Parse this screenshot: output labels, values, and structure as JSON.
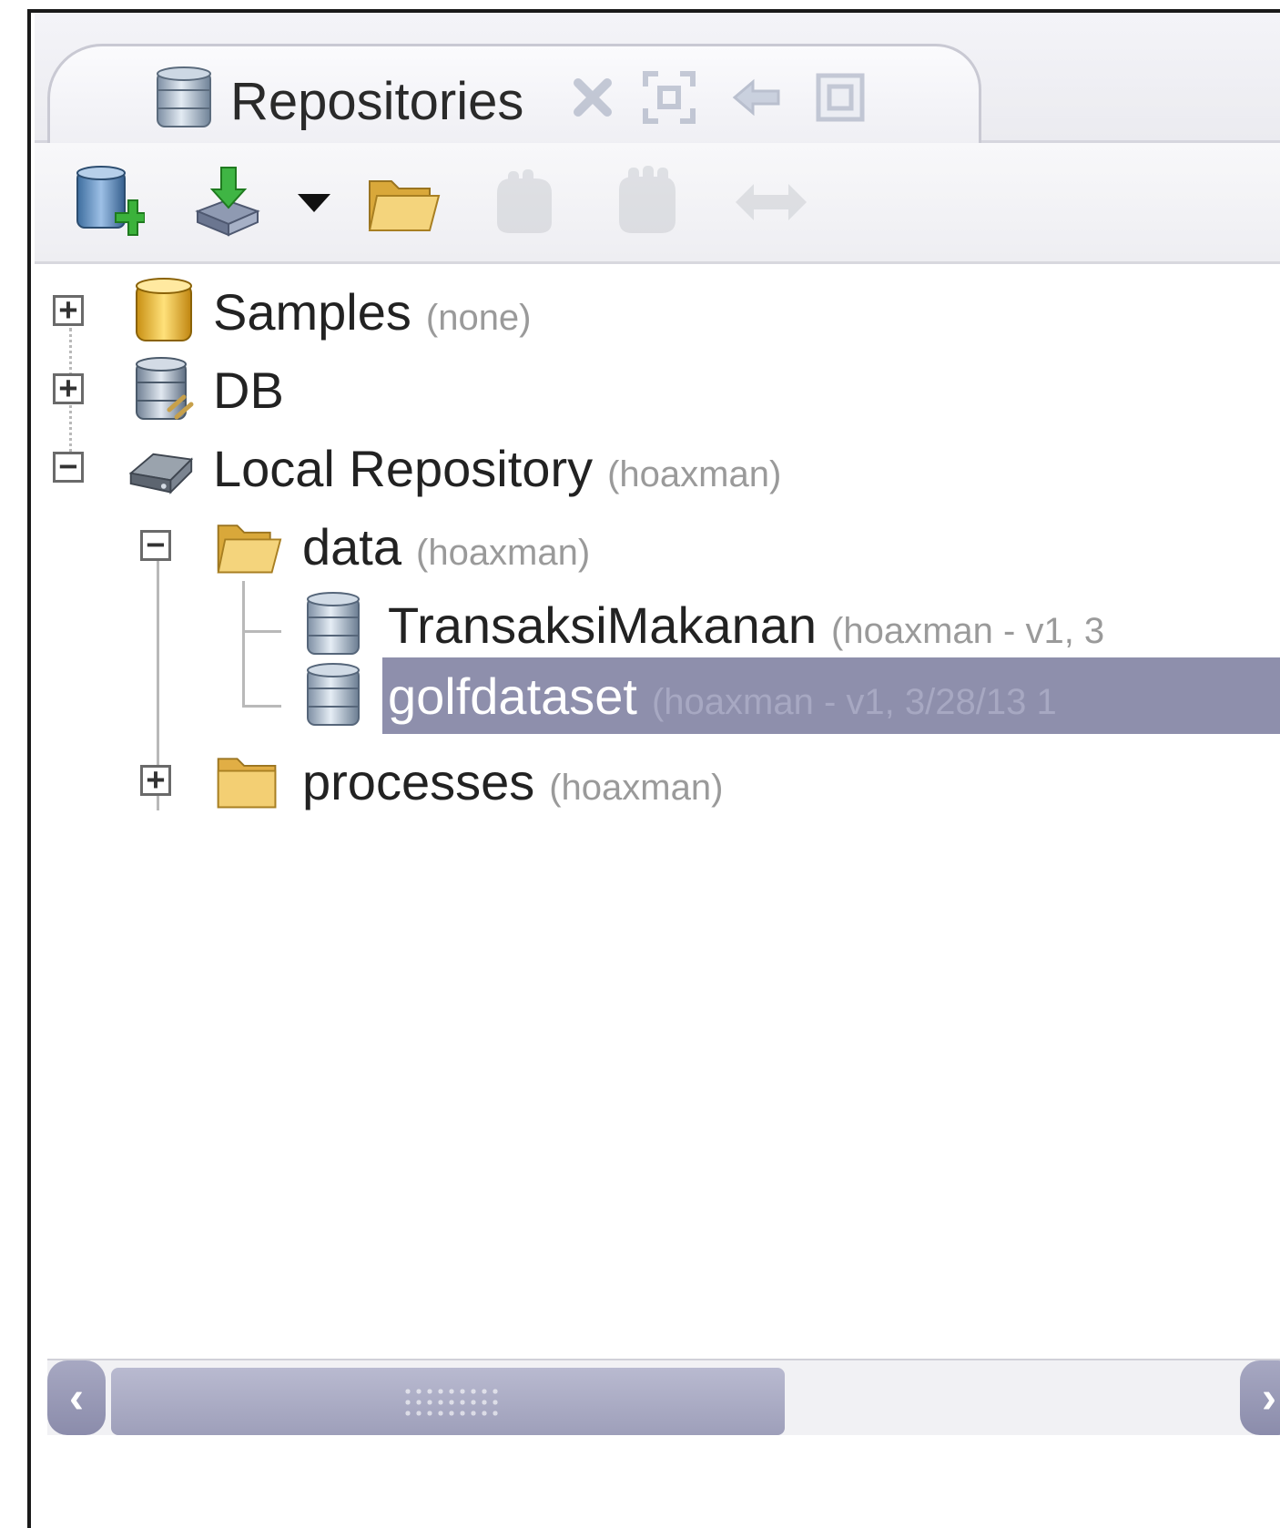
{
  "panel": {
    "title": "Repositories",
    "title_icon": "database-icon",
    "tab_actions": [
      "close-icon",
      "maximize-icon",
      "undock-icon",
      "restore-icon"
    ]
  },
  "toolbar": {
    "buttons": [
      {
        "name": "add-repository-button",
        "icon": "database-add-icon",
        "enabled": true
      },
      {
        "name": "import-button",
        "icon": "import-icon",
        "enabled": true
      },
      {
        "name": "import-dropdown-button",
        "icon": "chevron-down-icon",
        "enabled": true
      },
      {
        "name": "open-folder-button",
        "icon": "folder-open-icon",
        "enabled": true
      },
      {
        "name": "store-button",
        "icon": "store-icon",
        "enabled": false
      },
      {
        "name": "retrieve-button",
        "icon": "retrieve-icon",
        "enabled": false
      },
      {
        "name": "synchronize-button",
        "icon": "sync-icon",
        "enabled": false
      }
    ]
  },
  "tree": {
    "nodes": [
      {
        "label": "Samples",
        "meta": "(none)",
        "expanded": false,
        "icon": "samples-repository-icon"
      },
      {
        "label": "DB",
        "meta": "",
        "expanded": false,
        "icon": "database-repository-icon"
      },
      {
        "label": "Local Repository",
        "meta": "(hoaxman)",
        "expanded": true,
        "icon": "local-drive-icon"
      },
      {
        "label": "data",
        "meta": "(hoaxman)",
        "expanded": true,
        "icon": "folder-open-icon"
      },
      {
        "label": "TransaksiMakanan",
        "meta": "(hoaxman - v1, 3",
        "icon": "dataset-icon"
      },
      {
        "label": "golfdataset",
        "meta": "(hoaxman - v1, 3/28/13 1",
        "icon": "dataset-icon",
        "selected": true
      },
      {
        "label": "processes",
        "meta": "(hoaxman)",
        "expanded": false,
        "icon": "folder-icon"
      }
    ]
  },
  "colors": {
    "selection": "#8e8fac",
    "meta_text": "#9a9a9a",
    "folder": "#e9c25a",
    "database": "#9fb3c8"
  }
}
